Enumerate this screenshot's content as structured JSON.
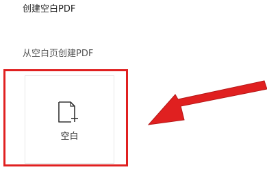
{
  "header": {
    "title": "创建空白PDF"
  },
  "section": {
    "label": "从空白页创建PDF"
  },
  "blank_card": {
    "label": "空白",
    "icon": "new-document-plus-icon"
  },
  "annotation": {
    "highlight_color": "#e02020",
    "arrow_color": "#e02020"
  }
}
